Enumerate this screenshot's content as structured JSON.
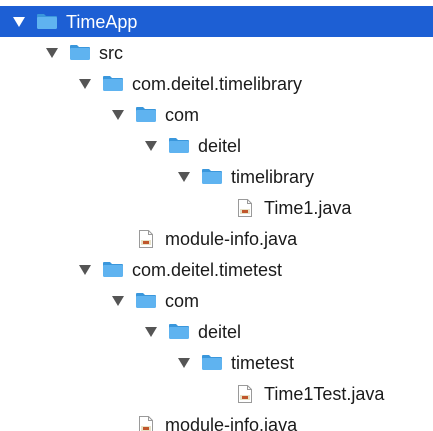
{
  "tree": {
    "items": [
      {
        "id": "timeapp",
        "label": "TimeApp",
        "type": "folder",
        "expanded": true,
        "selected": true,
        "depth": 0
      },
      {
        "id": "src",
        "label": "src",
        "type": "folder",
        "expanded": true,
        "selected": false,
        "depth": 1
      },
      {
        "id": "pkg-timelibrary",
        "label": "com.deitel.timelibrary",
        "type": "folder",
        "expanded": true,
        "selected": false,
        "depth": 2
      },
      {
        "id": "com-1",
        "label": "com",
        "type": "folder",
        "expanded": true,
        "selected": false,
        "depth": 3
      },
      {
        "id": "deitel-1",
        "label": "deitel",
        "type": "folder",
        "expanded": true,
        "selected": false,
        "depth": 4
      },
      {
        "id": "timelibrary",
        "label": "timelibrary",
        "type": "folder",
        "expanded": true,
        "selected": false,
        "depth": 5
      },
      {
        "id": "time1-java",
        "label": "Time1.java",
        "type": "java-file",
        "selected": false,
        "depth": 6
      },
      {
        "id": "module-info-1",
        "label": "module-info.java",
        "type": "java-file",
        "selected": false,
        "depth": 3
      },
      {
        "id": "pkg-timetest",
        "label": "com.deitel.timetest",
        "type": "folder",
        "expanded": true,
        "selected": false,
        "depth": 2
      },
      {
        "id": "com-2",
        "label": "com",
        "type": "folder",
        "expanded": true,
        "selected": false,
        "depth": 3
      },
      {
        "id": "deitel-2",
        "label": "deitel",
        "type": "folder",
        "expanded": true,
        "selected": false,
        "depth": 4
      },
      {
        "id": "timetest",
        "label": "timetest",
        "type": "folder",
        "expanded": true,
        "selected": false,
        "depth": 5
      },
      {
        "id": "time1test-java",
        "label": "Time1Test.java",
        "type": "java-file",
        "selected": false,
        "depth": 6
      },
      {
        "id": "module-info-2",
        "label": "module-info.java",
        "type": "java-file",
        "selected": false,
        "depth": 3
      }
    ]
  },
  "colors": {
    "selection": "#1d5fd4",
    "folder": "#5fb3f0",
    "folder_dark": "#3a97dc",
    "disclosure": "#555555"
  },
  "icons": {
    "folder": "folder-icon",
    "java_file": "java-file-icon",
    "expanded": "disclosure-triangle-down-icon"
  }
}
